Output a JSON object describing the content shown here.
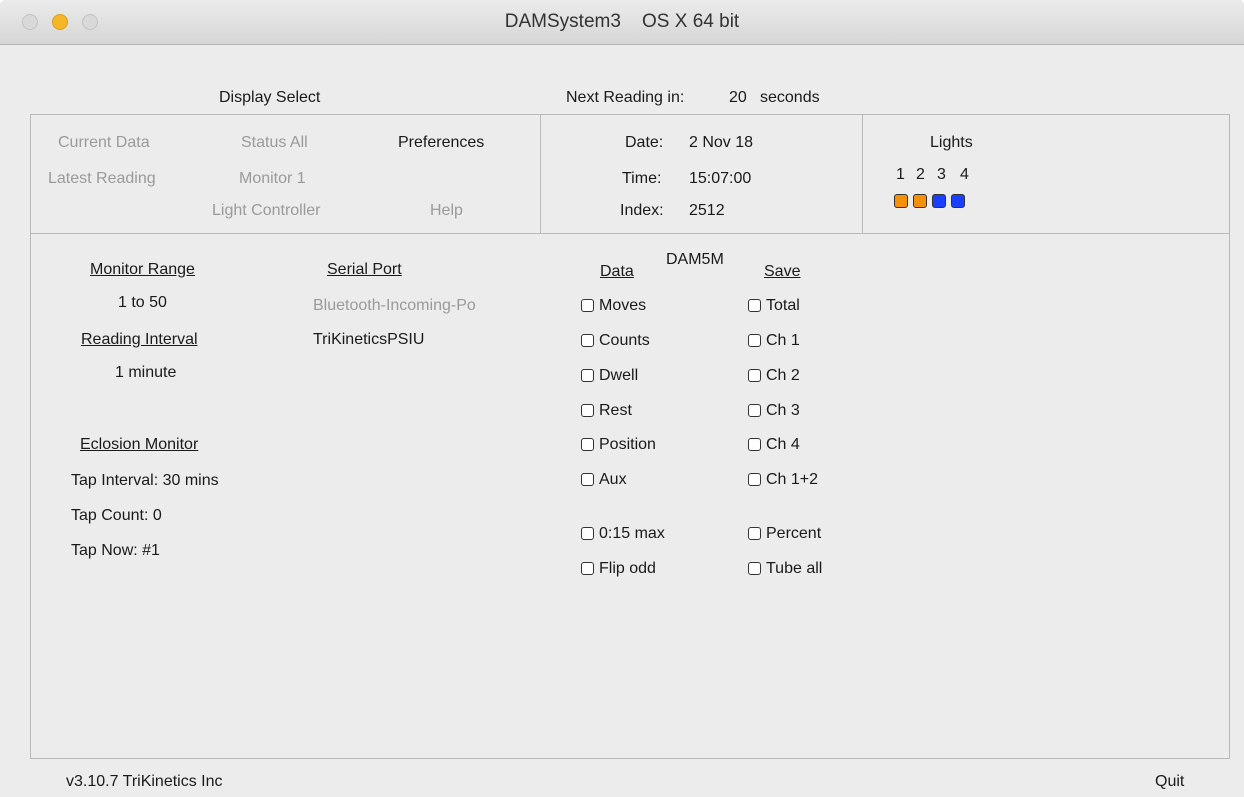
{
  "window": {
    "title": "DAMSystem3    OS X 64 bit"
  },
  "header": {
    "display_select": "Display Select",
    "next_reading_label": "Next Reading in:",
    "next_reading_value": "20",
    "next_reading_unit": "seconds"
  },
  "nav": {
    "current_data": "Current Data",
    "status_all": "Status All",
    "preferences": "Preferences",
    "latest_reading": "Latest Reading",
    "monitor_1": "Monitor 1",
    "light_controller": "Light Controller",
    "help": "Help"
  },
  "info": {
    "date_label": "Date:",
    "date_value": "2 Nov 18",
    "time_label": "Time:",
    "time_value": "15:07:00",
    "index_label": "Index:",
    "index_value": "2512"
  },
  "lights": {
    "title": "Lights",
    "numbers": [
      "1",
      "2",
      "3",
      "4"
    ],
    "colors": [
      "#f5900a",
      "#f5900a",
      "#1a3fff",
      "#1a3fff"
    ]
  },
  "prefs": {
    "monitor_range_label": "Monitor Range",
    "monitor_range_value": "1 to 50",
    "reading_interval_label": "Reading Interval",
    "reading_interval_value": "1 minute",
    "eclosion_monitor_label": "Eclosion Monitor",
    "tap_interval": "Tap Interval: 30 mins",
    "tap_count": "Tap Count: 0",
    "tap_now": "Tap Now: #1"
  },
  "serial": {
    "label": "Serial Port",
    "ports": [
      "Bluetooth-Incoming-Po",
      "TriKineticsPSIU"
    ]
  },
  "dam": {
    "title": "DAM5M",
    "data_header": "Data",
    "save_header": "Save",
    "data_options": [
      "Moves",
      "Counts",
      "Dwell",
      "Rest",
      "Position",
      "Aux"
    ],
    "save_options": [
      "Total",
      "Ch 1",
      "Ch 2",
      "Ch 3",
      "Ch 4",
      "Ch 1+2"
    ],
    "extra_left": [
      "0:15 max",
      "Flip odd"
    ],
    "extra_right": [
      "Percent",
      "Tube all"
    ]
  },
  "footer": {
    "version": "v3.10.7  TriKinetics Inc",
    "quit": "Quit"
  }
}
